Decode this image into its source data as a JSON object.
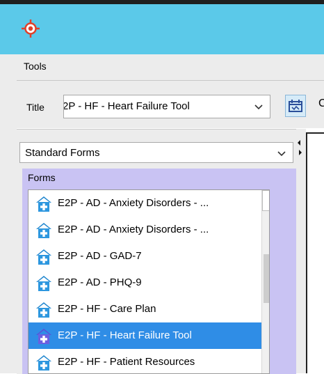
{
  "app": {
    "icon": "crosshair-target-icon"
  },
  "menubar": {
    "items": [
      {
        "label": "Tools"
      }
    ]
  },
  "toolbar": {
    "title_label": "Title",
    "title_value": "E2P - HF - Heart Failure Tool",
    "button_icon": "edit-calendar-icon",
    "truncated_text": "C"
  },
  "left_panel": {
    "forms_category": "Standard Forms",
    "forms_group_label": "Forms",
    "forms": [
      {
        "label": "E2P - AD - Anxiety Disorders - ...",
        "icon": "home-plus-icon"
      },
      {
        "label": "E2P - AD - Anxiety Disorders - ...",
        "icon": "home-plus-icon"
      },
      {
        "label": "E2P - AD - GAD-7",
        "icon": "home-plus-icon"
      },
      {
        "label": "E2P - AD - PHQ-9",
        "icon": "home-plus-icon"
      },
      {
        "label": "E2P - HF - Care Plan",
        "icon": "home-plus-icon"
      },
      {
        "label": "E2P - HF - Heart Failure Tool",
        "icon": "home-plus-icon",
        "selected": true
      },
      {
        "label": "E2P - HF - Patient Resources",
        "icon": "home-plus-icon"
      }
    ]
  },
  "colors": {
    "titlebar": "#5bc9e9",
    "selection": "#2f8de6",
    "forms_group": "#c9c3f3",
    "accent_icon": "#e0402a"
  }
}
